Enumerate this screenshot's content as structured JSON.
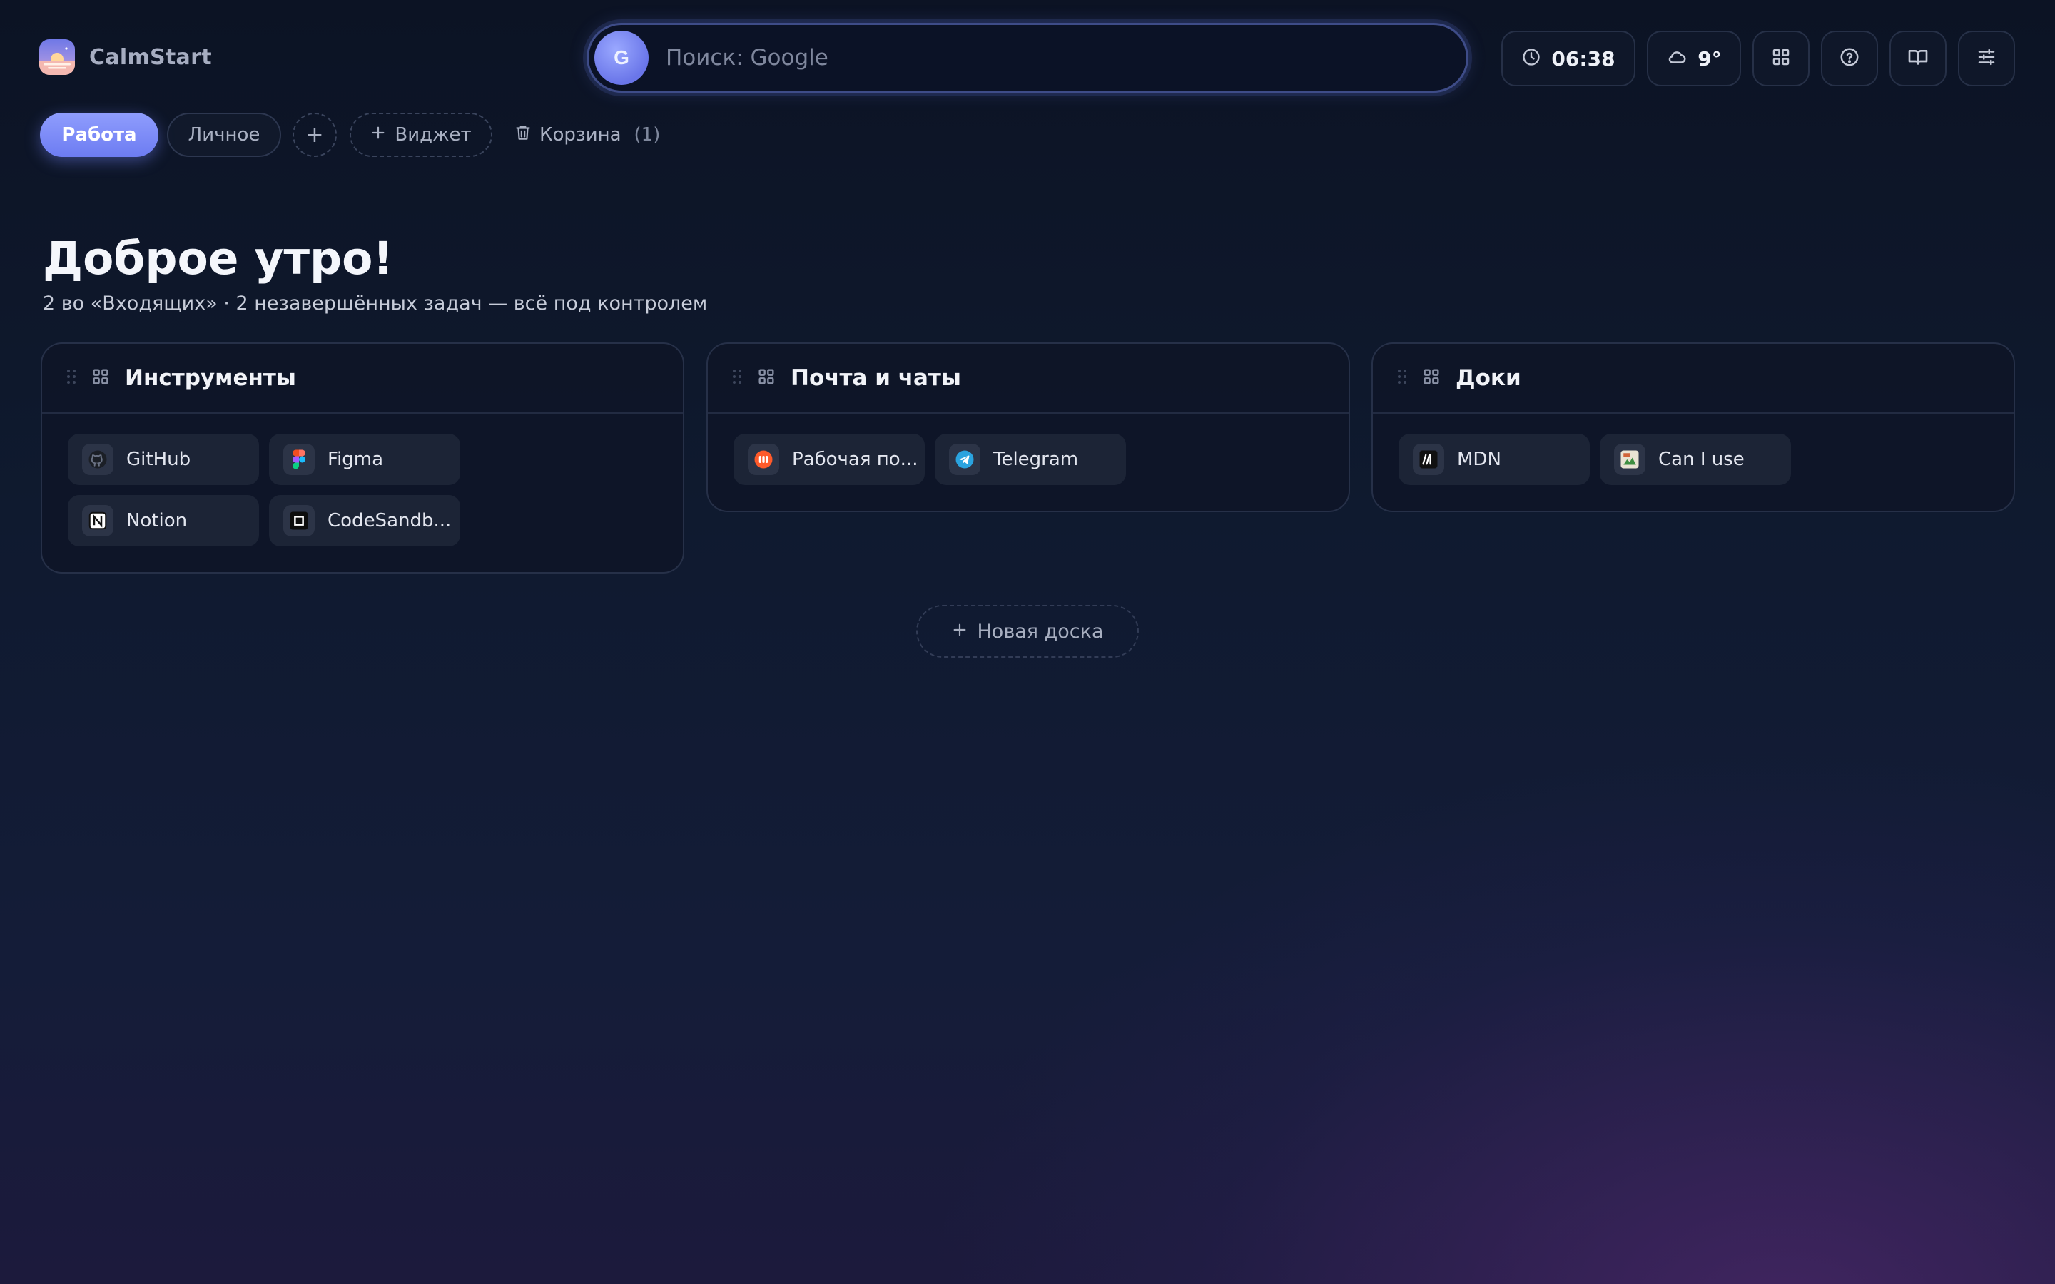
{
  "app": {
    "name": "CalmStart"
  },
  "search": {
    "engine_letter": "G",
    "placeholder": "Поиск: Google",
    "value": ""
  },
  "header": {
    "time": "06:38",
    "weather": "9°",
    "icons": [
      "clock-icon",
      "cloud-icon",
      "apps-grid-icon",
      "help-icon",
      "book-icon",
      "settings-sliders-icon"
    ]
  },
  "tabs": [
    {
      "label": "Работа",
      "active": true
    },
    {
      "label": "Личное",
      "active": false
    }
  ],
  "toolbar": {
    "add_tab": "+",
    "widget_label": "Виджет",
    "trash_label": "Корзина",
    "trash_count": "(1)"
  },
  "greeting": {
    "title": "Доброе утро!",
    "subtitle": "2 во «Входящих» · 2 незавершённых задач — всё под контролем"
  },
  "boards": [
    {
      "title": "Инструменты",
      "links": [
        {
          "label": "GitHub",
          "icon": "github-icon"
        },
        {
          "label": "Figma",
          "icon": "figma-icon"
        },
        {
          "label": "Notion",
          "icon": "notion-icon"
        },
        {
          "label": "CodeSandb...",
          "icon": "codesandbox-icon"
        }
      ]
    },
    {
      "title": "Почта и чаты",
      "links": [
        {
          "label": "Рабочая по...",
          "icon": "mail-icon"
        },
        {
          "label": "Telegram",
          "icon": "telegram-icon"
        }
      ]
    },
    {
      "title": "Доки",
      "links": [
        {
          "label": "MDN",
          "icon": "mdn-icon"
        },
        {
          "label": "Can I use",
          "icon": "caniuse-icon"
        }
      ]
    }
  ],
  "new_board": {
    "label": "Новая доска"
  },
  "colors": {
    "accent": "#7b89f6",
    "background": "#0f1a2f"
  }
}
